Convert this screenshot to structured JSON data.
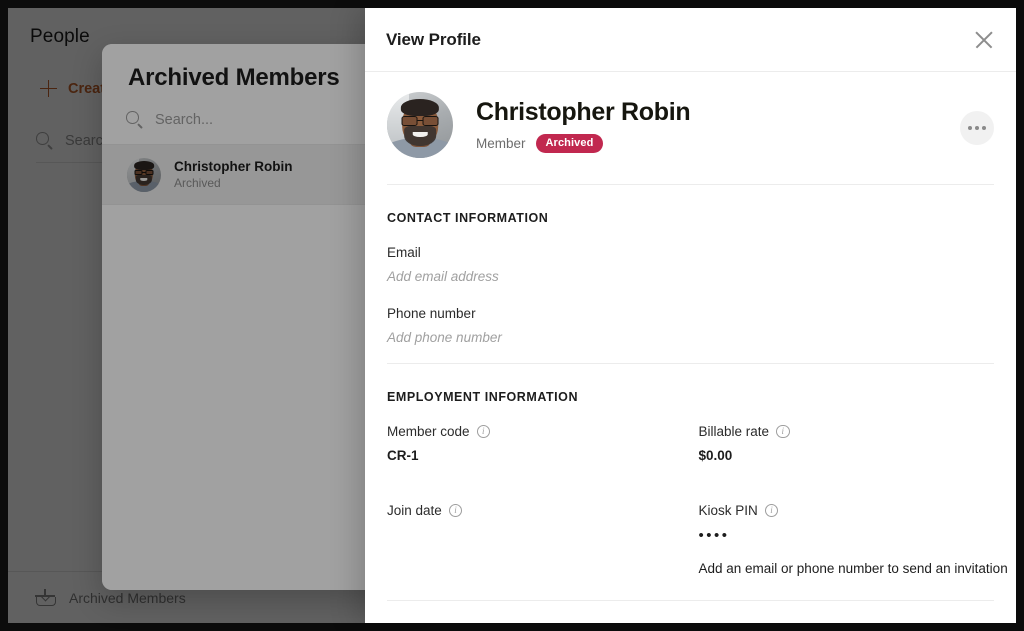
{
  "background_app": {
    "page_title": "People",
    "create_button_label": "Create",
    "search_placeholder": "Search g",
    "footer_item_label": "Archived Members",
    "footer_item_icon": "archive-inbox-icon",
    "plus_icon": "plus-icon",
    "search_icon": "search-icon",
    "accent_color": "#c4622a"
  },
  "archived_drawer": {
    "title": "Archived Members",
    "search_placeholder": "Search...",
    "search_icon": "search-icon",
    "members": [
      {
        "name": "Christopher Robin",
        "status": "Archived",
        "avatar": "avatar"
      }
    ]
  },
  "modal": {
    "title": "View Profile",
    "close_icon": "close-icon",
    "more_icon": "more-options-icon",
    "profile": {
      "avatar": "avatar",
      "name": "Christopher Robin",
      "role": "Member",
      "badge": "Archived",
      "badge_color": "#c1284f"
    },
    "contact_section": {
      "heading": "CONTACT INFORMATION",
      "fields": [
        {
          "label": "Email",
          "placeholder": "Add email address"
        },
        {
          "label": "Phone number",
          "placeholder": "Add phone number"
        }
      ]
    },
    "employment_section": {
      "heading": "EMPLOYMENT INFORMATION",
      "member_code": {
        "label": "Member code",
        "info_icon": "info-icon",
        "value": "CR-1"
      },
      "billable_rate": {
        "label": "Billable rate",
        "info_icon": "info-icon",
        "value": "$0.00"
      },
      "join_date": {
        "label": "Join date",
        "info_icon": "info-icon",
        "value": ""
      },
      "kiosk_pin": {
        "label": "Kiosk PIN",
        "info_icon": "info-icon",
        "value": "••••",
        "note": "Add an email or phone number to send an invitation"
      }
    }
  }
}
